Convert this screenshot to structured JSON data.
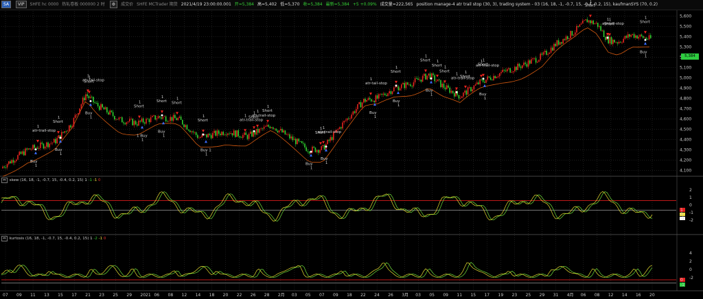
{
  "toolbar": {
    "symbol_btn": "SA",
    "vip_btn": "VIP",
    "contract": "SHFE hc 0000",
    "hot_label": "热轧卷板 000000 2 时",
    "settings_btn": "⚙",
    "adjust_label": "成交价",
    "source": "SHFE MCTrader 期货",
    "datetime": "2021/4/19 23:00:00.001",
    "open": "开=5,384",
    "high": "高=5,402",
    "low": "低=5,370",
    "close": "收=5,384",
    "last": "最新=5,384",
    "change": "+5 +0.09%",
    "volume": "成交量=222,565",
    "studies": "position manage-4 atr trail stop (30, 3), trading system - 03 (16, 18, -1, -0.7, 15, -0.4, 0.2, 15), kaufmanSYS (70, 0.2)"
  },
  "main_axis": {
    "ticks": [
      "5,600",
      "5,500",
      "5,400",
      "5,300",
      "5,200",
      "5,100",
      "5,000",
      "4,900",
      "4,800",
      "4,700",
      "4,600",
      "4,500",
      "4,400",
      "4,300",
      "4,200",
      "4,100"
    ],
    "last_price": "5,384"
  },
  "skew_panel": {
    "icon": "⇔",
    "name": "skew",
    "params": "(16, 18, -1, -0.7, 15, -0.4, 0.2, 15)",
    "v1": "1",
    "v2": "-1",
    "v3": "-1",
    "v4": "0",
    "axis": [
      "2",
      "1",
      "0",
      "-1",
      "-2"
    ],
    "markers": [
      "1",
      "0",
      "-1"
    ]
  },
  "kurt_panel": {
    "icon": "⇔",
    "name": "kurtosis",
    "params": "(16, 18, -1, -0.7, 15, -0.4, 0.2, 15)",
    "v1": "1",
    "v2": "-2",
    "v3": "-1",
    "v4": "0",
    "axis": [
      "4",
      "2",
      "0",
      "-2"
    ],
    "markers": [
      "0",
      "-1"
    ]
  },
  "x_axis": [
    "07",
    "09",
    "11",
    "13",
    "15",
    "17",
    "21",
    "23",
    "25",
    "29",
    "2021",
    "06",
    "08",
    "12",
    "14",
    "18",
    "20",
    "22",
    "26",
    "28",
    "2月",
    "03",
    "05",
    "07",
    "09",
    "18",
    "22",
    "24",
    "26",
    "3月",
    "03",
    "05",
    "09",
    "11",
    "15",
    "17",
    "19",
    "23",
    "25",
    "29",
    "31",
    "4月",
    "06",
    "08",
    "12",
    "14",
    "16",
    "20"
  ],
  "signals": {
    "short": "Short",
    "buy": "Buy",
    "one": "1",
    "atr": "atr-trail-stop",
    "atr_short": "atr-tail-stop",
    "one_buy": "1 Buy",
    "buy_one": "Buy 1"
  },
  "colors": {
    "bull": "#e8241e",
    "bear": "#2fd12f",
    "atr_line": "#d55a10",
    "threshold": "#ff2020",
    "zero": "#ffffff",
    "osc": "#6fe03a",
    "osc2": "#e8e030",
    "buy": "#3a6cff"
  }
}
